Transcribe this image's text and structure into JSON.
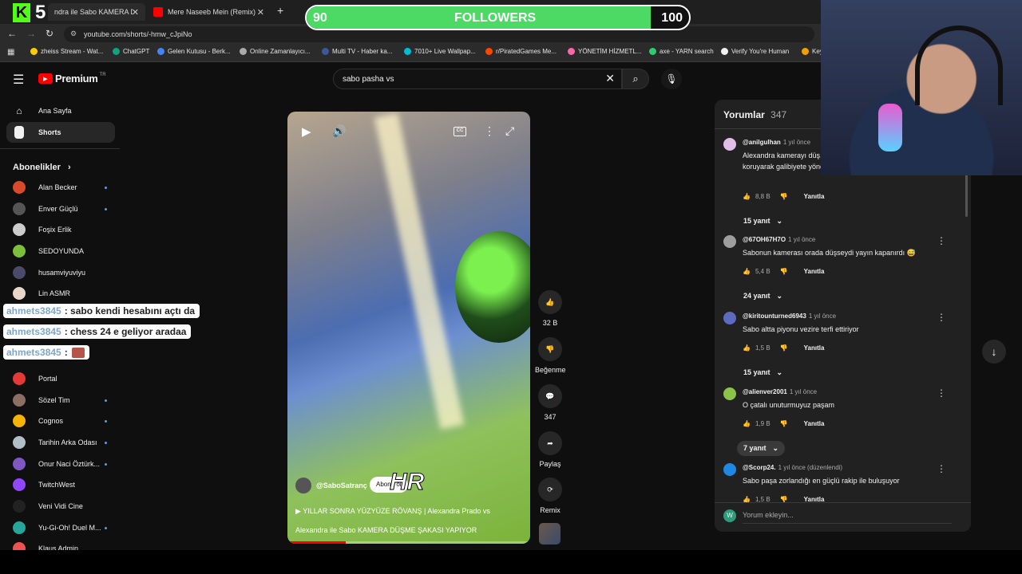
{
  "browser": {
    "tabs": [
      {
        "title": "ndra ile Sabo KAMERA DÜ",
        "active": true
      },
      {
        "title": "Mere Naseeb Mein (Remix) - Ba",
        "active": false
      }
    ],
    "url": "youtube.com/shorts/-hmw_cJpiNo",
    "bookmarks": [
      "zheiss Stream - Wat...",
      "ChatGPT",
      "Gelen Kutusu - Berk...",
      "Online Zamanlayıcı...",
      "Multi TV - Haber ka...",
      "7010+ Live Wallpap...",
      "r/PiratedGames Me...",
      "YÖNETİM HİZMETL...",
      "axe - YARN search",
      "Verify You're Human",
      "Key"
    ]
  },
  "overlay": {
    "logo_number": "5",
    "followers": {
      "current": "90",
      "label": "FOLLOWERS",
      "goal": "100",
      "progress": 0.9
    },
    "chat": [
      {
        "user": "ahmets3845",
        "message": ": sabo kendi hesabını açtı da"
      },
      {
        "user": "ahmets3845",
        "message": ": chess 24 e geliyor aradaa"
      },
      {
        "user": "ahmets3845",
        "message": ":"
      }
    ]
  },
  "youtube": {
    "brand": "Premium",
    "country": "TR",
    "search_value": "sabo pasha vs",
    "nav": [
      {
        "label": "Ana Sayfa",
        "icon": "home-icon"
      },
      {
        "label": "Shorts",
        "icon": "shorts-icon",
        "active": true
      }
    ],
    "subscriptions_title": "Abonelikler",
    "subscriptions": [
      {
        "name": "Alan Becker",
        "color": "#d94a2b",
        "live": true
      },
      {
        "name": "Enver Güçlü",
        "color": "#555555",
        "live": true
      },
      {
        "name": "Foşix Erlik",
        "color": "#cccccc",
        "live": false
      },
      {
        "name": "SEDOYUNDA",
        "color": "#7bbf3a",
        "live": false
      },
      {
        "name": "husamviyuviyu",
        "color": "#4a4a6a",
        "live": false
      },
      {
        "name": "Lin ASMR",
        "color": "#e8d7c8",
        "live": false
      },
      {
        "name": "Portal",
        "color": "#e53935",
        "live": false
      },
      {
        "name": "Sözel Tim",
        "color": "#8d6e63",
        "live": true
      },
      {
        "name": "Cognos",
        "color": "#f4b400",
        "live": true
      },
      {
        "name": "Tarihin Arka Odası",
        "color": "#b0bec5",
        "live": true
      },
      {
        "name": "Onur Naci Öztürk...",
        "color": "#7e57c2",
        "live": true
      },
      {
        "name": "TwitchWest",
        "color": "#9146ff",
        "live": false
      },
      {
        "name": "Veni Vidi Cine",
        "color": "#222222",
        "live": false
      },
      {
        "name": "Yu-Gi-Oh! Duel M...",
        "color": "#26a69a",
        "live": true
      },
      {
        "name": "Klaus Admin",
        "color": "#ef5350",
        "live": false
      }
    ],
    "short": {
      "channel": "@SaboSatranç",
      "subscribe": "Abone ol",
      "title_line1": "YILLAR SONRA YÜZYÜZE RÖVANŞ | Alexandra Prado vs",
      "title_line2": "Alexandra ile Sabo KAMERA DÜŞME ŞAKASI YAPIYOR",
      "watermark": "HR"
    },
    "actions": [
      {
        "label": "32 B",
        "icon": "like-icon"
      },
      {
        "label": "Beğenme",
        "icon": "dislike-icon"
      },
      {
        "label": "347",
        "icon": "comment-icon"
      },
      {
        "label": "Paylaş",
        "icon": "share-icon"
      },
      {
        "label": "Remix",
        "icon": "remix-icon"
      }
    ],
    "comments_panel": {
      "title": "Yorumlar",
      "count": "347",
      "add_placeholder": "Yorum ekleyin...",
      "avatar_letter": "W",
      "reply_label": "Yanıtla",
      "comments": [
        {
          "author": "@anilgulhan",
          "time": "1 yıl önce",
          "text": "Alexandra kamerayı düş... sanıyor fakat Sabo paşa... koruyarak galibiyete yöneliyor tercih ediyor. GOAT",
          "likes": "8,8 B",
          "replies": "15 yanıt",
          "color": "#e1bee7"
        },
        {
          "author": "@67OH67H7O",
          "time": "1 yıl önce",
          "text": "Sabonun kamerası orada düşseydi yayın kapanırdı 😅",
          "likes": "5,4 B",
          "replies": "24 yanıt",
          "color": "#9e9e9e"
        },
        {
          "author": "@kiritounturned6943",
          "time": "1 yıl önce",
          "text": "Sabo altta piyonu vezire terfi ettiriyor",
          "likes": "1,5 B",
          "replies": "15 yanıt",
          "color": "#5c6bc0"
        },
        {
          "author": "@alienver2001",
          "time": "1 yıl önce",
          "text": "O çatalı unuturmuyuz paşam",
          "likes": "1,9 B",
          "replies": "7 yanıt",
          "color": "#8bc34a"
        },
        {
          "author": "@Scorp24.",
          "time": "1 yıl önce (düzenlendi)",
          "text": "Sabo paşa zorlandığı en güçlü rakip ile buluşuyor",
          "likes": "1,5 B",
          "replies": "",
          "color": "#1e88e5"
        }
      ]
    }
  }
}
